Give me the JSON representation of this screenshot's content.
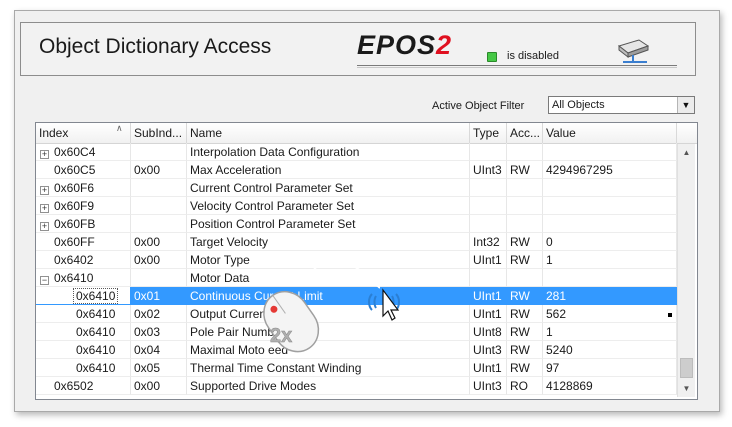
{
  "header": {
    "title": "Object Dictionary Access",
    "brand_text": "EPOS",
    "brand_num": "2",
    "status_text": "is disabled",
    "status_color": "#46c846"
  },
  "filter": {
    "label": "Active Object Filter",
    "value": "All Objects"
  },
  "table": {
    "columns": [
      "Index",
      "SubInd...",
      "Name",
      "Type",
      "Acc...",
      "Value"
    ],
    "rows": [
      {
        "tree": "plus",
        "index": "0x60C4",
        "sub": "",
        "name": "Interpolation Data Configuration",
        "type": "",
        "access": "",
        "value": ""
      },
      {
        "tree": "line",
        "index": "0x60C5",
        "sub": "0x00",
        "name": "Max Acceleration",
        "type": "UInt3",
        "access": "RW",
        "value": "4294967295"
      },
      {
        "tree": "plus",
        "index": "0x60F6",
        "sub": "",
        "name": "Current Control Parameter Set",
        "type": "",
        "access": "",
        "value": ""
      },
      {
        "tree": "plus",
        "index": "0x60F9",
        "sub": "",
        "name": "Velocity Control Parameter Set",
        "type": "",
        "access": "",
        "value": ""
      },
      {
        "tree": "plus",
        "index": "0x60FB",
        "sub": "",
        "name": "Position Control Parameter Set",
        "type": "",
        "access": "",
        "value": ""
      },
      {
        "tree": "line",
        "index": "0x60FF",
        "sub": "0x00",
        "name": "Target Velocity",
        "type": "Int32",
        "access": "RW",
        "value": "0"
      },
      {
        "tree": "line",
        "index": "0x6402",
        "sub": "0x00",
        "name": "Motor Type",
        "type": "UInt1",
        "access": "RW",
        "value": "1"
      },
      {
        "tree": "minus",
        "index": "0x6410",
        "sub": "",
        "name": "Motor Data",
        "type": "",
        "access": "",
        "value": ""
      },
      {
        "tree": "child",
        "index": "0x6410",
        "sub": "0x01",
        "name": "Continuous Current Limit",
        "type": "UInt1",
        "access": "RW",
        "value": "281",
        "selected": true
      },
      {
        "tree": "child",
        "index": "0x6410",
        "sub": "0x02",
        "name": "Output Current Li",
        "type": "UInt1",
        "access": "RW",
        "value": "562"
      },
      {
        "tree": "child",
        "index": "0x6410",
        "sub": "0x03",
        "name": "Pole Pair Numb",
        "type": "UInt8",
        "access": "RW",
        "value": "1"
      },
      {
        "tree": "child",
        "index": "0x6410",
        "sub": "0x04",
        "name": "Maximal Moto      eed",
        "type": "UInt3",
        "access": "RW",
        "value": "5240"
      },
      {
        "tree": "child",
        "index": "0x6410",
        "sub": "0x05",
        "name": "Thermal Time Constant Winding",
        "type": "UInt1",
        "access": "RW",
        "value": "97"
      },
      {
        "tree": "line",
        "index": "0x6502",
        "sub": "0x00",
        "name": "Supported Drive Modes",
        "type": "UInt3",
        "access": "RO",
        "value": "4128869"
      }
    ]
  },
  "overlay": {
    "mouse_label": "2x"
  }
}
